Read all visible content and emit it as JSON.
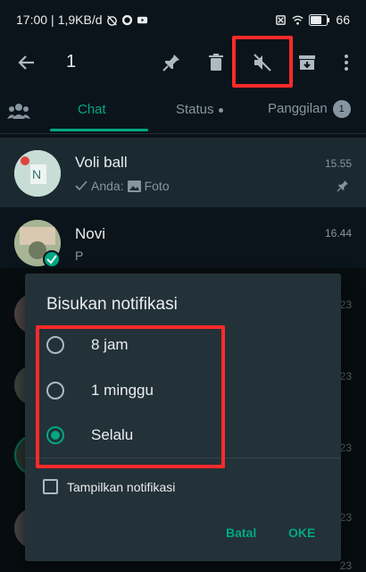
{
  "status_bar": {
    "time": "17:00",
    "network_speed": "1,9KB/d",
    "battery": "66"
  },
  "toolbar": {
    "selected_count": "1"
  },
  "tabs": [
    {
      "label": "Chat",
      "active": true
    },
    {
      "label": "Status",
      "active": false
    },
    {
      "label": "Panggilan",
      "active": false,
      "badge": "1"
    }
  ],
  "chats": [
    {
      "name": "Voli ball",
      "time": "15.55",
      "preview_prefix": "Anda:",
      "preview": "Foto",
      "pinned": true,
      "selected": true
    },
    {
      "name": "Novi",
      "time": "16.44",
      "preview": "P",
      "pinned": false,
      "selected": false
    }
  ],
  "background_times": [
    "23",
    "23",
    "23",
    "23",
    "23"
  ],
  "dialog": {
    "title": "Bisukan notifikasi",
    "options": [
      {
        "label": "8 jam",
        "checked": false
      },
      {
        "label": "1 minggu",
        "checked": false
      },
      {
        "label": "Selalu",
        "checked": true
      }
    ],
    "checkbox_label": "Tampilkan notifikasi",
    "cancel": "Batal",
    "ok": "OKE"
  },
  "colors": {
    "accent": "#00a884",
    "highlight": "#ff2a2a",
    "background": "#0b141a",
    "dialog": "#233138"
  }
}
